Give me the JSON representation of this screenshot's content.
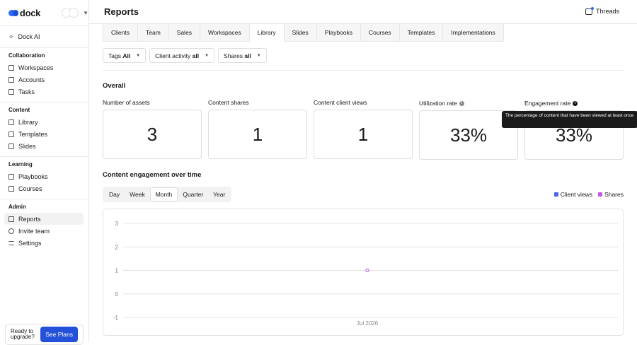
{
  "brand": {
    "name": "dock"
  },
  "sidebar": {
    "ai_item": {
      "label": "Dock AI",
      "icon": "sparkle-icon"
    },
    "groups": [
      {
        "heading": "Collaboration",
        "items": [
          {
            "label": "Workspaces",
            "icon": "grid-icon"
          },
          {
            "label": "Accounts",
            "icon": "building-icon"
          },
          {
            "label": "Tasks",
            "icon": "checkbox-icon"
          }
        ]
      },
      {
        "heading": "Content",
        "items": [
          {
            "label": "Library",
            "icon": "library-icon"
          },
          {
            "label": "Templates",
            "icon": "template-icon"
          },
          {
            "label": "Slides",
            "icon": "slides-icon"
          }
        ]
      },
      {
        "heading": "Learning",
        "items": [
          {
            "label": "Playbooks",
            "icon": "playbook-icon"
          },
          {
            "label": "Courses",
            "icon": "course-icon"
          }
        ]
      },
      {
        "heading": "Admin",
        "items": [
          {
            "label": "Reports",
            "icon": "chart-icon",
            "active": true
          },
          {
            "label": "Invite team",
            "icon": "users-icon"
          },
          {
            "label": "Settings",
            "icon": "sliders-icon"
          }
        ]
      }
    ],
    "upgrade": {
      "text": "Ready to upgrade?",
      "button": "See Plans"
    }
  },
  "header": {
    "title": "Reports",
    "threads_label": "Threads"
  },
  "tabs": [
    "Clients",
    "Team",
    "Sales",
    "Workspaces",
    "Library",
    "Slides",
    "Playbooks",
    "Courses",
    "Templates",
    "Implementations"
  ],
  "active_tab": "Library",
  "filters": [
    {
      "label": "Tags",
      "value": "All"
    },
    {
      "label": "Client activity",
      "value": "all"
    },
    {
      "label": "Shares",
      "value": "all"
    }
  ],
  "overall": {
    "title": "Overall",
    "stats": [
      {
        "label": "Number of assets",
        "value": "3"
      },
      {
        "label": "Content shares",
        "value": "1"
      },
      {
        "label": "Content client views",
        "value": "1"
      },
      {
        "label": "Utilization rate",
        "value": "33%"
      },
      {
        "label": "Engagement rate",
        "value": "33%"
      }
    ],
    "tooltip": "The percentage of content that have been viewed at least once"
  },
  "engagement": {
    "title": "Content engagement over time",
    "periods": [
      "Day",
      "Week",
      "Month",
      "Quarter",
      "Year"
    ],
    "active_period": "Month",
    "legend": [
      {
        "name": "Client views",
        "color": "#4a63e8"
      },
      {
        "name": "Shares",
        "color": "#c157e6"
      }
    ]
  },
  "chart_data": {
    "type": "line",
    "x": [
      "Jul 2026"
    ],
    "series": [
      {
        "name": "Client views",
        "values": [
          1
        ]
      },
      {
        "name": "Shares",
        "values": [
          1
        ]
      }
    ],
    "yticks": [
      3,
      2,
      1,
      0,
      -1
    ],
    "ylim": [
      -1,
      3
    ],
    "xlabel": "",
    "ylabel": "",
    "grid": true,
    "legend_position": "top-right"
  }
}
